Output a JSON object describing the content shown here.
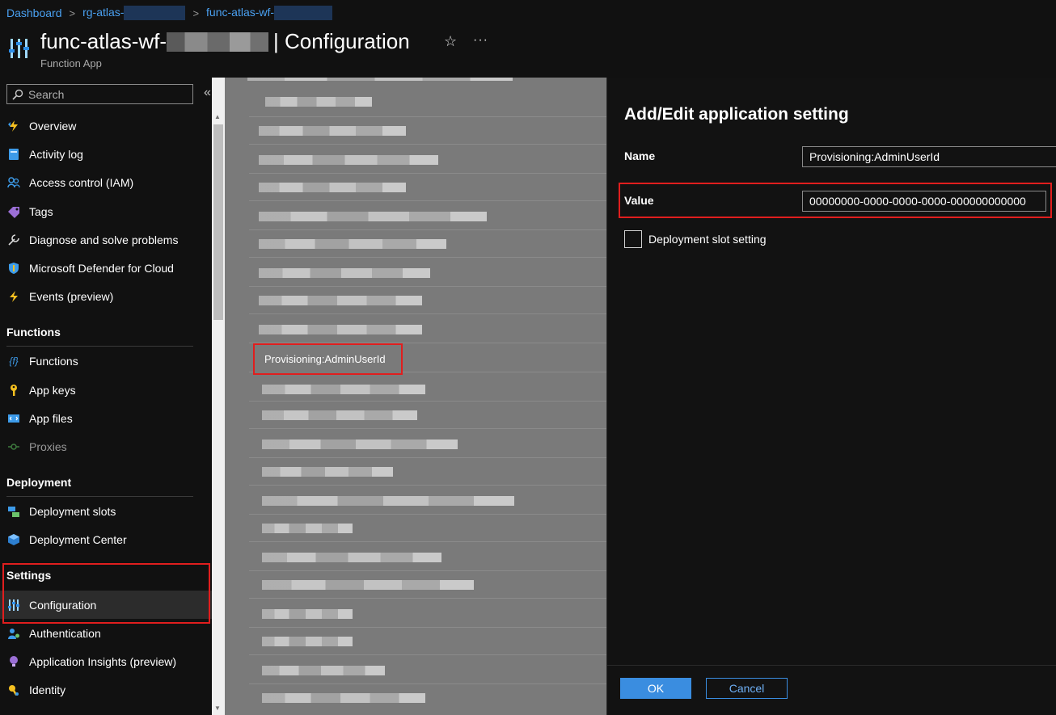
{
  "breadcrumb": {
    "items": [
      {
        "label": "Dashboard"
      },
      {
        "label": "rg-atlas-"
      },
      {
        "label": "func-atlas-wf-"
      }
    ]
  },
  "header": {
    "title_prefix": "func-atlas-wf-",
    "title_suffix": "| Configuration",
    "subtitle": "Function App",
    "star_glyph": "☆",
    "more_glyph": "···"
  },
  "sidebar": {
    "search_placeholder": "Search",
    "collapse_glyph": "«",
    "groups": {
      "top": [
        {
          "label": "Overview",
          "icon": "lightning-icon"
        },
        {
          "label": "Activity log",
          "icon": "activity-log-icon"
        },
        {
          "label": "Access control (IAM)",
          "icon": "people-icon"
        },
        {
          "label": "Tags",
          "icon": "tag-icon"
        },
        {
          "label": "Diagnose and solve problems",
          "icon": "wrench-icon"
        },
        {
          "label": "Microsoft Defender for Cloud",
          "icon": "shield-icon"
        },
        {
          "label": "Events (preview)",
          "icon": "bolt-icon"
        }
      ],
      "functions_heading": "Functions",
      "functions": [
        {
          "label": "Functions",
          "icon": "function-icon"
        },
        {
          "label": "App keys",
          "icon": "key-icon"
        },
        {
          "label": "App files",
          "icon": "code-file-icon"
        },
        {
          "label": "Proxies",
          "icon": "proxy-icon"
        }
      ],
      "deployment_heading": "Deployment",
      "deployment": [
        {
          "label": "Deployment slots",
          "icon": "slots-icon"
        },
        {
          "label": "Deployment Center",
          "icon": "cube-icon"
        }
      ],
      "settings_heading": "Settings",
      "settings": [
        {
          "label": "Configuration",
          "icon": "config-sliders-icon",
          "active": true
        },
        {
          "label": "Authentication",
          "icon": "user-auth-icon"
        },
        {
          "label": "Application Insights (preview)",
          "icon": "lightbulb-icon"
        },
        {
          "label": "Identity",
          "icon": "identity-key-icon"
        }
      ]
    }
  },
  "content": {
    "highlighted_setting": "Provisioning:AdminUserId"
  },
  "panel": {
    "title": "Add/Edit application setting",
    "name_label": "Name",
    "name_value": "Provisioning:AdminUserId",
    "value_label": "Value",
    "value_value": "00000000-0000-0000-0000-000000000000",
    "slot_setting_label": "Deployment slot setting",
    "slot_setting_checked": false,
    "ok_label": "OK",
    "cancel_label": "Cancel"
  },
  "colors": {
    "accent": "#3a8de0",
    "link": "#4aa0f0",
    "highlight": "#e01e1e"
  }
}
